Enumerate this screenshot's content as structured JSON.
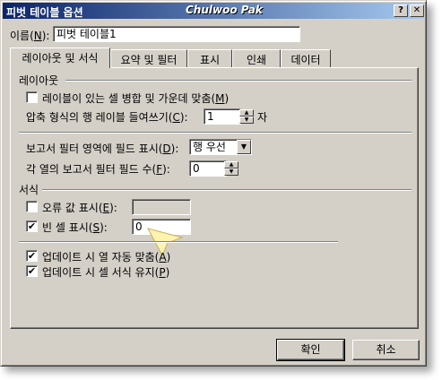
{
  "window": {
    "title": "피벗 테이블 옵션",
    "watermark": "Chulwoo Pak",
    "help_label": "?",
    "close_label": "✕"
  },
  "name": {
    "label": "이름(",
    "hotkey": "N",
    "label_end": "):",
    "value": "피벗 테이블1"
  },
  "tabs": [
    {
      "label": "레이아웃 및 서식"
    },
    {
      "label": "요약 및 필터"
    },
    {
      "label": "표시"
    },
    {
      "label": "인쇄"
    },
    {
      "label": "데이터"
    }
  ],
  "layout_section": {
    "heading": "레이아웃",
    "merge_center": {
      "label": "레이블이 있는 셀 병합 및 가운데 맞춤(",
      "hotkey": "M",
      "end": ")",
      "checked": false
    },
    "indent": {
      "label": "압축 형식의 행 레이블 들여쓰기(",
      "hotkey": "C",
      "end": "):",
      "value": "1",
      "unit": "자"
    },
    "report_filter_area": {
      "label": "보고서 필터 영역에 필드 표시(",
      "hotkey": "D",
      "end": "):",
      "value": "행 우선"
    },
    "report_filter_fields": {
      "label": "각 열의 보고서 필터 필드 수(",
      "hotkey": "F",
      "end": "):",
      "value": "0"
    }
  },
  "format_section": {
    "heading": "서식",
    "error_values": {
      "label": "오류 값 표시(",
      "hotkey": "E",
      "end": "):",
      "checked": false,
      "value": ""
    },
    "empty_cells": {
      "label": "빈 셀 표시(",
      "hotkey": "S",
      "end": "):",
      "checked": true,
      "value": "0"
    },
    "autofit": {
      "label": "업데이트 시 열 자동 맞춤(",
      "hotkey": "A",
      "end": ")",
      "checked": true
    },
    "preserve_format": {
      "label": "업데이트 시 셀 서식 유지(",
      "hotkey": "P",
      "end": ")",
      "checked": true
    }
  },
  "buttons": {
    "ok": "확인",
    "cancel": "취소"
  },
  "check_mark": "✔"
}
